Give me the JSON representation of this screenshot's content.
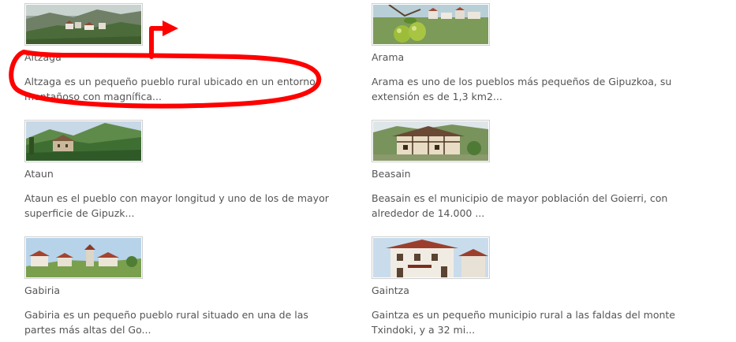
{
  "colors": {
    "annotation": "#ff0000",
    "text": "#555555",
    "thumb_border": "#cfcfcf"
  },
  "towns": [
    {
      "name": "Altzaga",
      "description": "Altzaga es un pequeño pueblo rural ubicado en un entorno montañoso con magnífica...",
      "image": "Altzaga village landscape"
    },
    {
      "name": "Arama",
      "description": "Arama es uno de los pueblos más pequeños de Gipuzkoa, su extensión es de 1,3 km2...",
      "image": "Apples in front of village"
    },
    {
      "name": "Ataun",
      "description": "Ataun es el pueblo con mayor longitud y uno de los de mayor superficie de Gipuzk...",
      "image": "Ataun green hills"
    },
    {
      "name": "Beasain",
      "description": "Beasain es el municipio de mayor población del Goierri, con alrededor de 14.000 ...",
      "image": "Beasain half-timbered house"
    },
    {
      "name": "Gabiria",
      "description": "Gabiria es un pequeño pueblo rural situado en una de las partes más altas del Go...",
      "image": "Gabiria hilltop village"
    },
    {
      "name": "Gaintza",
      "description": "Gaintza es un pequeño municipio rural a las faldas del monte Txindoki, y a 32 mi...",
      "image": "Gaintza stone house"
    }
  ]
}
